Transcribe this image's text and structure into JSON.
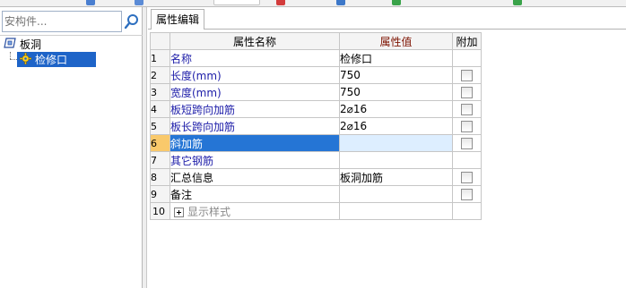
{
  "search": {
    "placeholder": "安构件..."
  },
  "tree": {
    "root_label": "板洞",
    "child_label": "检修口"
  },
  "tab": {
    "label": "属性编辑"
  },
  "grid": {
    "headers": {
      "name": "属性名称",
      "value": "属性值",
      "extra": "附加"
    },
    "rows": [
      {
        "num": "1",
        "name": "名称",
        "value": "检修口",
        "checkbox": false
      },
      {
        "num": "2",
        "name": "长度(mm)",
        "value": "750",
        "checkbox": true
      },
      {
        "num": "3",
        "name": "宽度(mm)",
        "value": "750",
        "checkbox": true
      },
      {
        "num": "4",
        "name": "板短跨向加筋",
        "value": "2⌀16",
        "checkbox": true
      },
      {
        "num": "5",
        "name": "板长跨向加筋",
        "value": "2⌀16",
        "checkbox": true
      },
      {
        "num": "6",
        "name": "斜加筋",
        "value": "",
        "checkbox": true
      },
      {
        "num": "7",
        "name": "其它钢筋",
        "value": "",
        "checkbox": false
      },
      {
        "num": "8",
        "name": "汇总信息",
        "value": "板洞加筋",
        "checkbox": true
      },
      {
        "num": "9",
        "name": "备注",
        "value": "",
        "checkbox": true
      },
      {
        "num": "10",
        "name": "显示样式",
        "value": "",
        "checkbox": false
      }
    ]
  },
  "colors": {
    "selection_blue": "#2575d5",
    "header_value_gradient": "#f7b84f",
    "name_text_blue": "#1c1ca8"
  }
}
